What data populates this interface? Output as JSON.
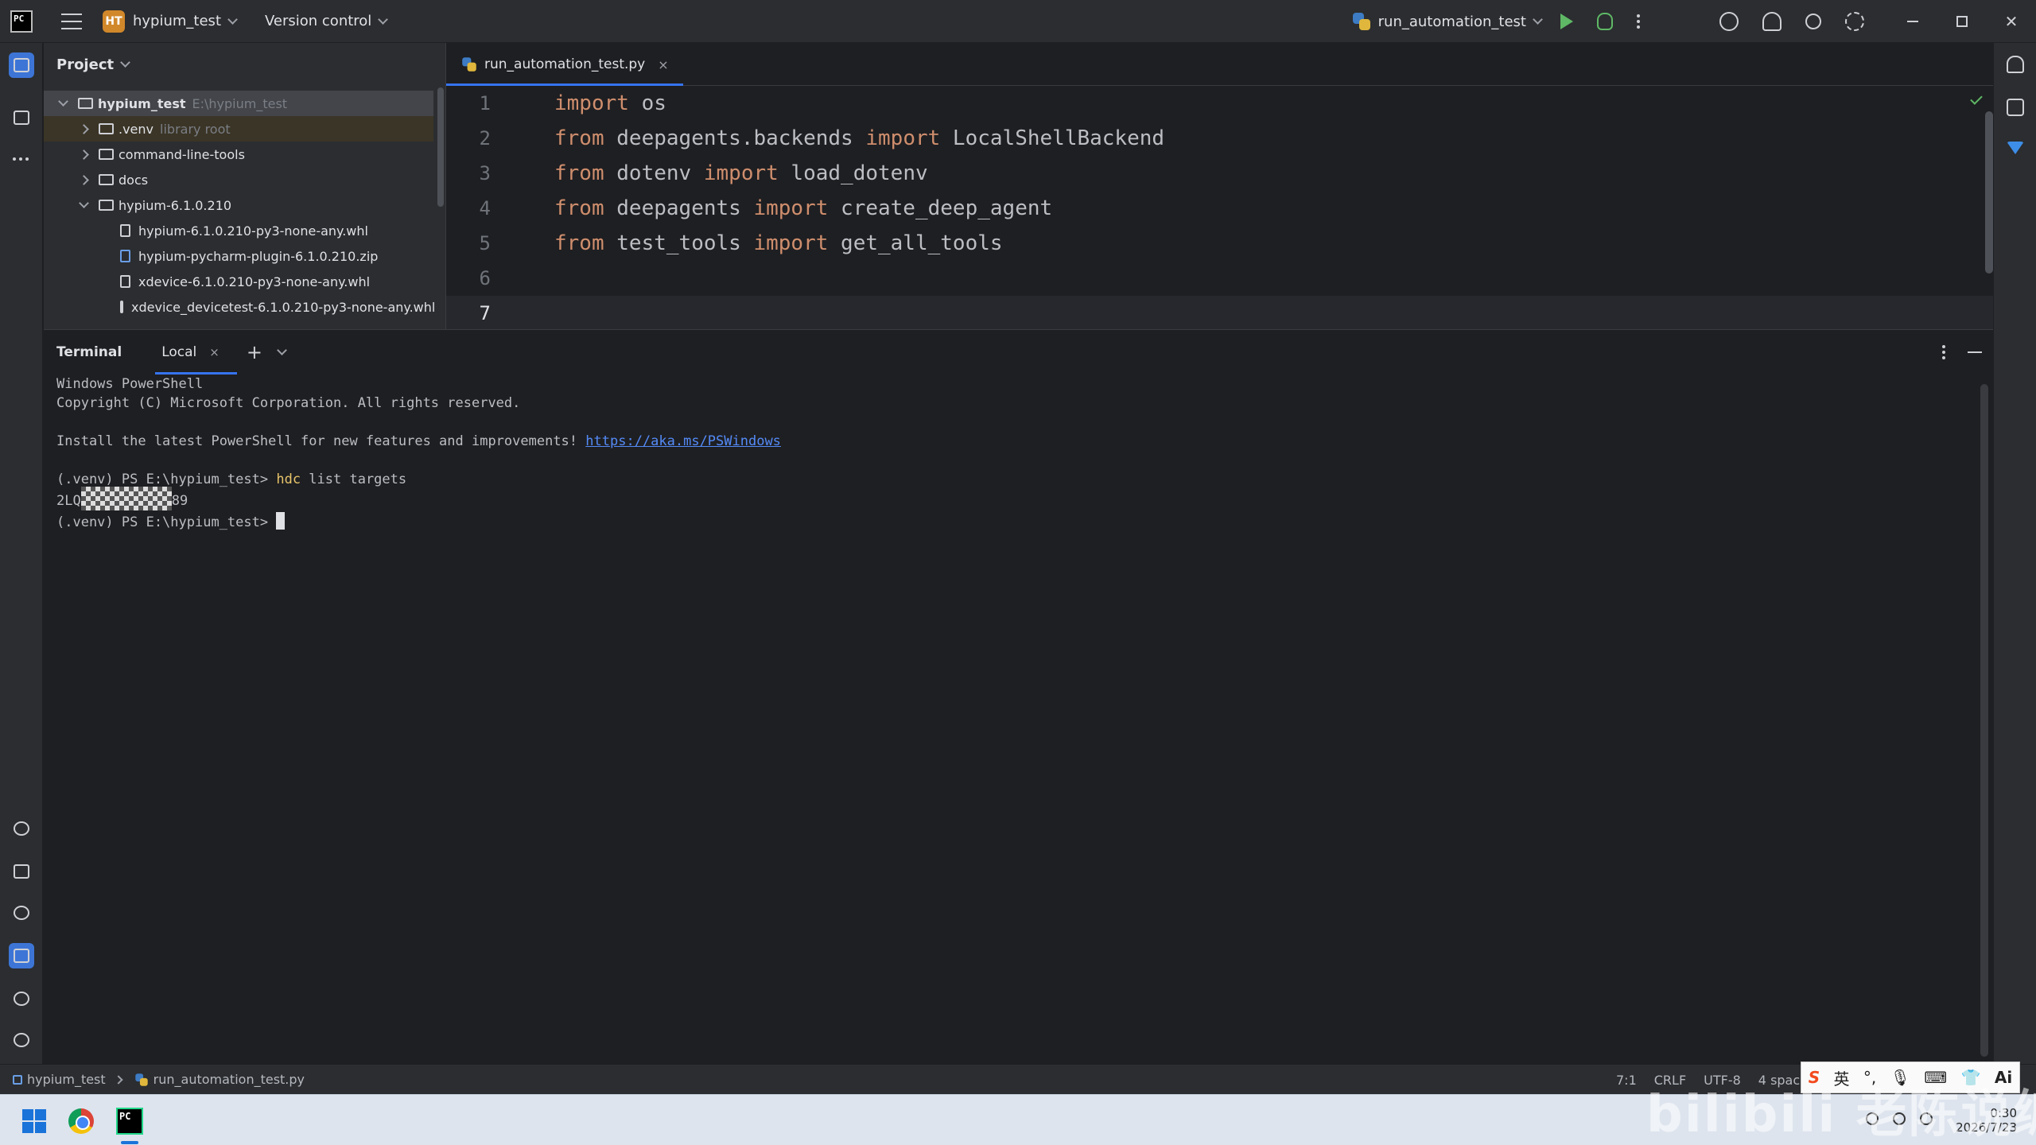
{
  "titlebar": {
    "app_logo": "PC",
    "project_badge": "HT",
    "project_name": "hypium_test",
    "version_control": "Version control",
    "run_config": "run_automation_test"
  },
  "project_panel": {
    "title": "Project",
    "tree": [
      {
        "label": "hypium_test",
        "hint": "E:\\hypium_test"
      },
      {
        "label": ".venv",
        "hint": "library root"
      },
      {
        "label": "command-line-tools"
      },
      {
        "label": "docs"
      },
      {
        "label": "hypium-6.1.0.210"
      },
      {
        "label": "hypium-6.1.0.210-py3-none-any.whl"
      },
      {
        "label": "hypium-pycharm-plugin-6.1.0.210.zip"
      },
      {
        "label": "xdevice-6.1.0.210-py3-none-any.whl"
      },
      {
        "label": "xdevice_devicetest-6.1.0.210-py3-none-any.whl"
      }
    ]
  },
  "editor": {
    "tab_label": "run_automation_test.py",
    "tab_close": "×",
    "lines": [
      {
        "n": "1",
        "kw1": "import",
        "rest1": " os",
        "kw2": "",
        "rest2": ""
      },
      {
        "n": "2",
        "kw1": "from",
        "rest1": " deepagents.backends ",
        "kw2": "import",
        "rest2": " LocalShellBackend"
      },
      {
        "n": "3",
        "kw1": "from",
        "rest1": " dotenv ",
        "kw2": "import",
        "rest2": " load_dotenv"
      },
      {
        "n": "4",
        "kw1": "from",
        "rest1": " deepagents ",
        "kw2": "import",
        "rest2": " create_deep_agent"
      },
      {
        "n": "5",
        "kw1": "from",
        "rest1": " test_tools ",
        "kw2": "import",
        "rest2": " get_all_tools"
      },
      {
        "n": "6",
        "kw1": "",
        "rest1": "",
        "kw2": "",
        "rest2": ""
      },
      {
        "n": "7",
        "kw1": "",
        "rest1": "",
        "kw2": "",
        "rest2": ""
      }
    ]
  },
  "terminal": {
    "title": "Terminal",
    "tab_label": "Local",
    "tab_close": "×",
    "plus": "+",
    "lines": {
      "l1": "Windows PowerShell",
      "l2": "Copyright (C) Microsoft Corporation. All rights reserved.",
      "l3": "Install the latest PowerShell for new features and improvements! ",
      "l3_link": "https://aka.ms/PSWindows",
      "l4_prompt": "(.venv) PS E:\\hypium_test> ",
      "l4_cmd": "hdc",
      "l4_args": " list targets",
      "l5_prefix": "2LQ",
      "l5_suffix": "89",
      "l6_prompt": "(.venv) PS E:\\hypium_test> "
    }
  },
  "statusbar": {
    "crumb_project": "hypium_test",
    "crumb_file": "run_automation_test.py",
    "position": "7:1",
    "line_sep": "CRLF",
    "encoding": "UTF-8",
    "indent": "4 spac"
  },
  "ime": {
    "logo": "S",
    "lang": "英"
  },
  "taskbar": {
    "pc_label": "PC",
    "time": "0:30",
    "date": "2026/7/23"
  },
  "watermark": "bilibili 老陈说编程"
}
